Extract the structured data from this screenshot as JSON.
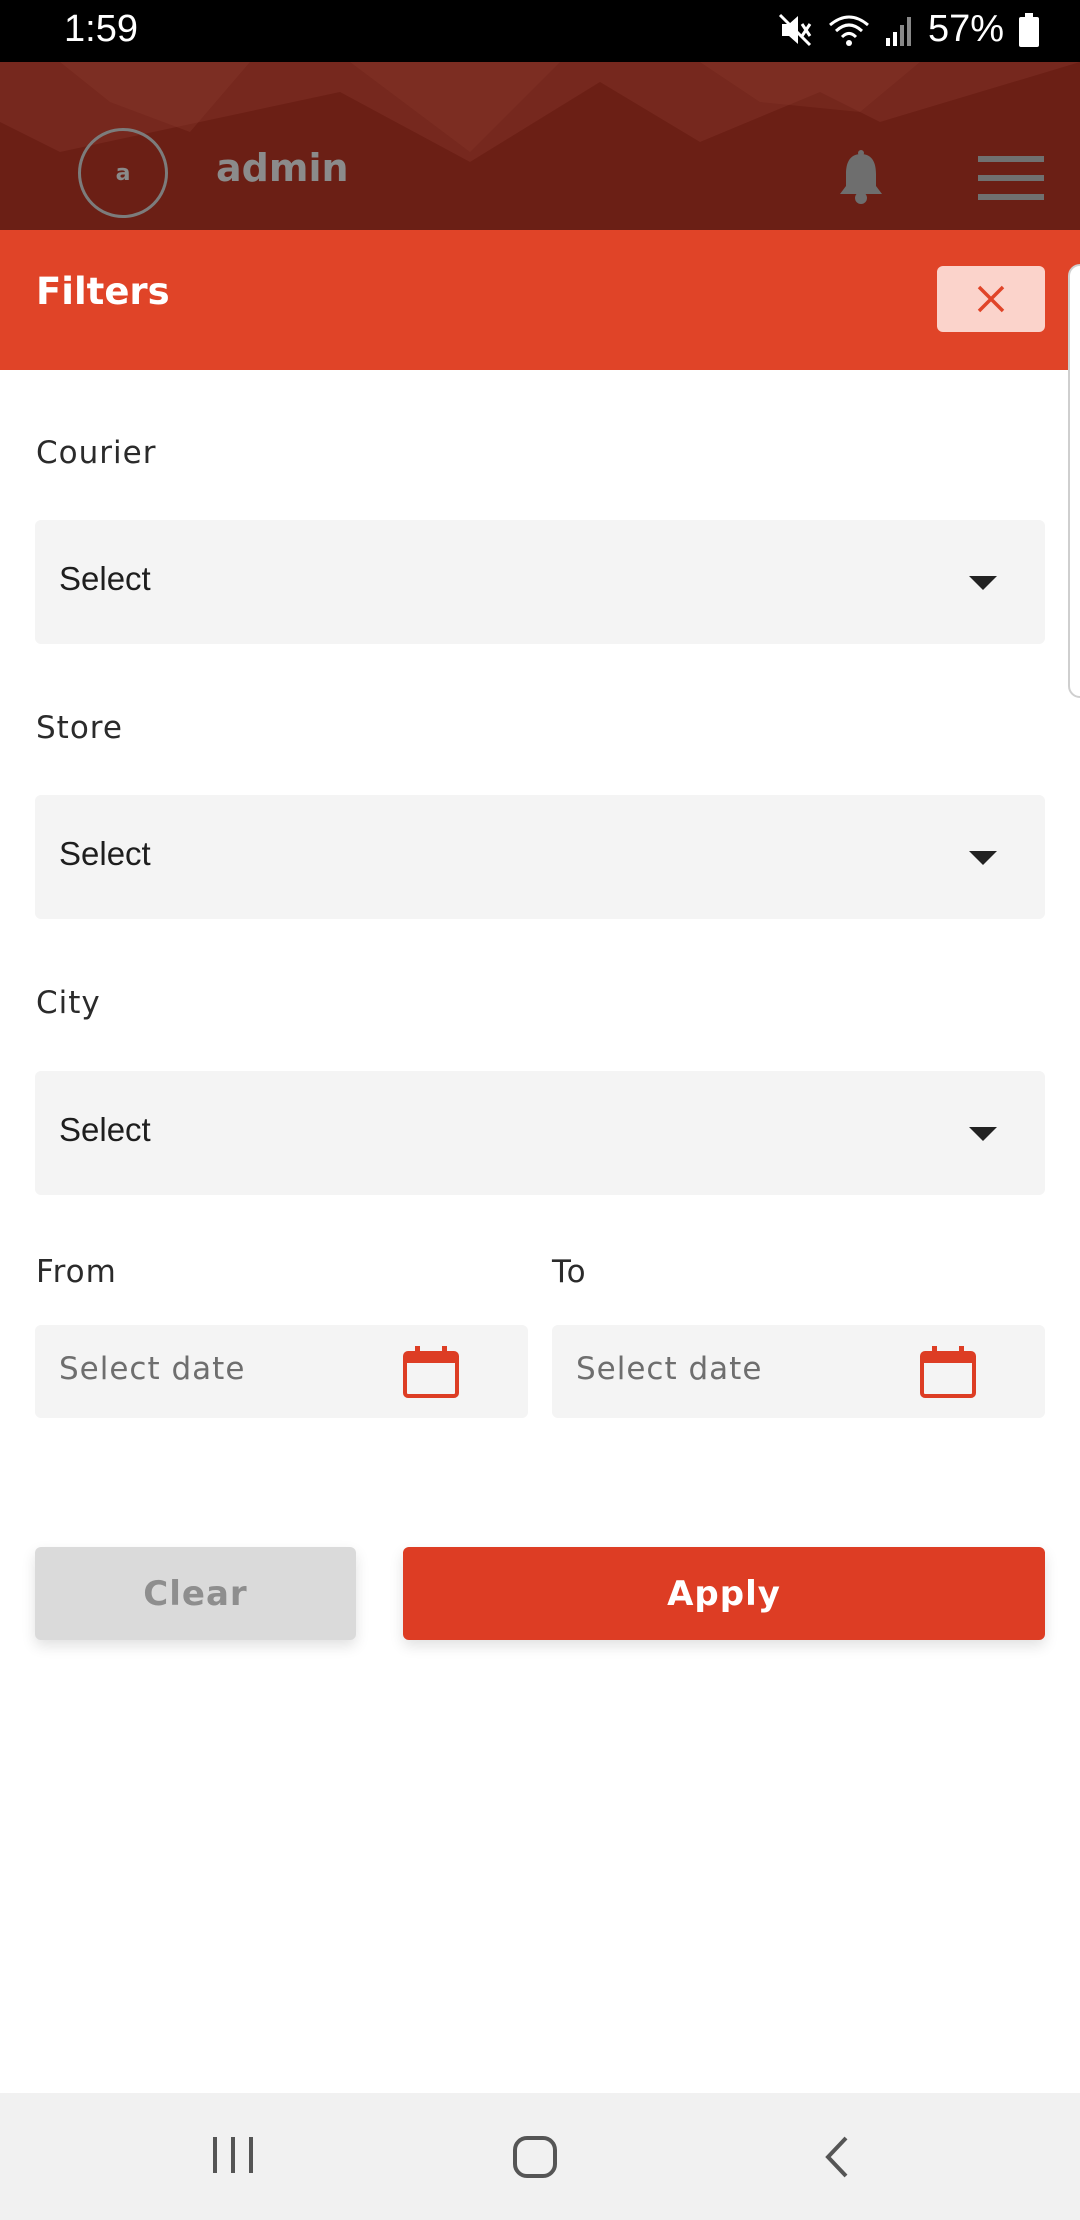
{
  "status_bar": {
    "time": "1:59",
    "battery": "57%",
    "icons": [
      "mute-icon",
      "wifi-icon",
      "signal-icon",
      "battery-icon"
    ]
  },
  "header": {
    "avatar_initial": "a",
    "username": "admin",
    "icons": [
      "bell-icon",
      "hamburger-menu-icon"
    ]
  },
  "filters": {
    "title": "Filters",
    "close_icon": "close-icon",
    "courier": {
      "label": "Courier",
      "value": "Select"
    },
    "store": {
      "label": "Store",
      "value": "Select"
    },
    "city": {
      "label": "City",
      "value": "Select"
    },
    "from": {
      "label": "From",
      "placeholder": "Select date"
    },
    "to": {
      "label": "To",
      "placeholder": "Select date"
    },
    "clear_label": "Clear",
    "apply_label": "Apply"
  },
  "nav_bar": {
    "icons": [
      "recent-apps-icon",
      "home-icon",
      "back-icon"
    ]
  },
  "colors": {
    "filters_bar": "#e04428",
    "header": "#6b1f15",
    "apply_button": "#dd3d24",
    "clear_button": "#dadada",
    "field_background": "#f4f4f4"
  }
}
